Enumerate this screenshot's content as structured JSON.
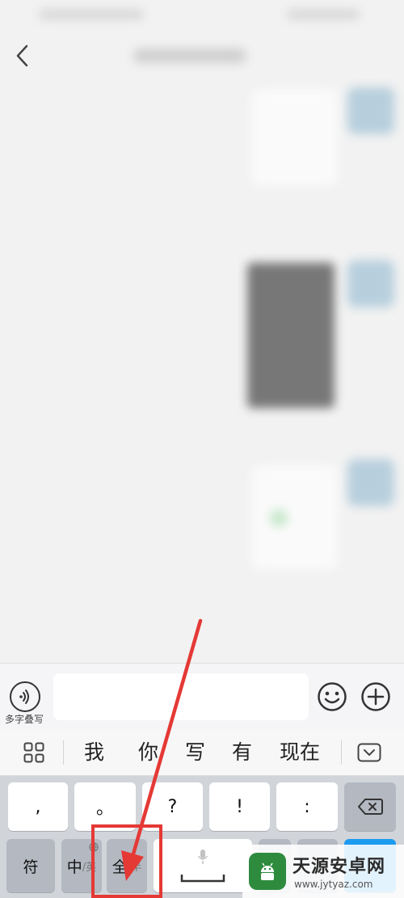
{
  "input_bar": {
    "voice_label": "多字叠写",
    "text_value": "",
    "icons": [
      "voice-wave-icon",
      "emoji-icon",
      "plus-icon"
    ]
  },
  "candidates": {
    "items": [
      "我",
      "你",
      "写",
      "有",
      "现在"
    ],
    "icons": [
      "grid-icon",
      "collapse-keyboard-icon"
    ]
  },
  "keyboard": {
    "row1": [
      ",",
      "。",
      "?",
      "!",
      ":"
    ],
    "row2": {
      "symbol": "符",
      "lang_main": "中",
      "lang_sub": "/英",
      "width_main": "全",
      "width_sub": "/半"
    }
  },
  "watermark": {
    "title": "天源安卓网",
    "url": "www.jytyaz.com"
  },
  "colors": {
    "annotation": "#e53935",
    "accent": "#1d9bf0",
    "logo": "#2e8b3e"
  }
}
